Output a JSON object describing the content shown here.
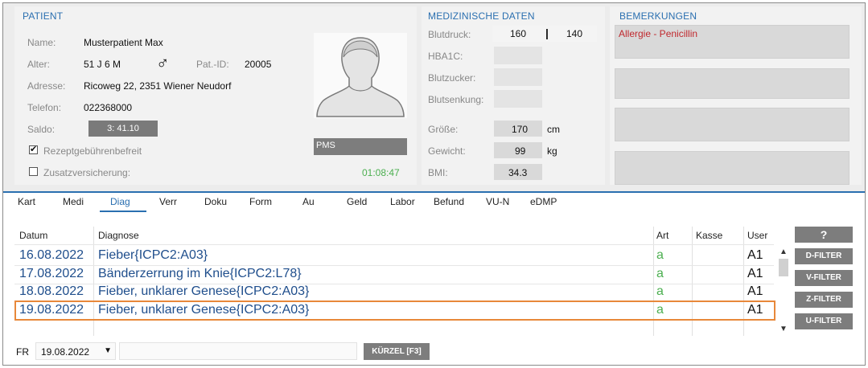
{
  "patient": {
    "section_title": "PATIENT",
    "name_label": "Name:",
    "name_value": "Musterpatient Max",
    "age_label": "Alter:",
    "age_value": "51 J 6 M",
    "gender_symbol": "♂",
    "patid_label": "Pat.-ID:",
    "patid_value": "20005",
    "address_label": "Adresse:",
    "address_value": "Ricoweg 22, 2351 Wiener Neudorf",
    "phone_label": "Telefon:",
    "phone_value": "022368000",
    "saldo_label": "Saldo:",
    "saldo_value": "3: 41.10",
    "rezept_label": "Rezeptgebührenbefreit",
    "rezept_checked": true,
    "zusatz_label": "Zusatzversicherung:",
    "zusatz_checked": false,
    "pms_label": "PMS",
    "timer": "01:08:47"
  },
  "medical": {
    "section_title": "MEDIZINISCHE DATEN",
    "blutdruck_label": "Blutdruck:",
    "blutdruck_sys": "160",
    "blutdruck_sep": "|",
    "blutdruck_dia": "140",
    "hba1c_label": "HBA1C:",
    "blutzucker_label": "Blutzucker:",
    "blutsenkung_label": "Blutsenkung:",
    "groesse_label": "Größe:",
    "groesse_value": "170",
    "groesse_unit": "cm",
    "gewicht_label": "Gewicht:",
    "gewicht_value": "99",
    "gewicht_unit": "kg",
    "bmi_label": "BMI:",
    "bmi_value": "34.3"
  },
  "remarks": {
    "section_title": "BEMERKUNGEN",
    "note1": "Allergie - Penicillin"
  },
  "tabs": [
    "Kart",
    "Medi",
    "Diag",
    "Verr",
    "Doku",
    "Form",
    "Au",
    "Geld",
    "Labor",
    "Befund",
    "VU-N",
    "eDMP"
  ],
  "active_tab": "Diag",
  "table": {
    "headers": {
      "datum": "Datum",
      "diagnose": "Diagnose",
      "art": "Art",
      "kasse": "Kasse",
      "user": "User"
    },
    "rows": [
      {
        "datum": "16.08.2022",
        "diagnose": "Fieber{ICPC2:A03}",
        "art": "a",
        "kasse": "",
        "user": "A1"
      },
      {
        "datum": "17.08.2022",
        "diagnose": "Bänderzerrung im Knie{ICPC2:L78}",
        "art": "a",
        "kasse": "",
        "user": "A1"
      },
      {
        "datum": "18.08.2022",
        "diagnose": "Fieber, unklarer Genese{ICPC2:A03}",
        "art": "a",
        "kasse": "",
        "user": "A1"
      },
      {
        "datum": "19.08.2022",
        "diagnose": "Fieber, unklarer Genese{ICPC2:A03}",
        "art": "a",
        "kasse": "",
        "user": "A1"
      }
    ]
  },
  "filters": {
    "help": "?",
    "d": "D-FILTER",
    "v": "V-FILTER",
    "z": "Z-FILTER",
    "u": "U-FILTER"
  },
  "bottom": {
    "fr_label": "FR",
    "date_value": "19.08.2022",
    "input_value": "",
    "kuerzel_button": "KÜRZEL [F3]"
  },
  "colors": {
    "accent": "#2a6fb0",
    "highlight": "#e8883a",
    "timer": "#4caf50",
    "note_text": "#c0282d"
  }
}
